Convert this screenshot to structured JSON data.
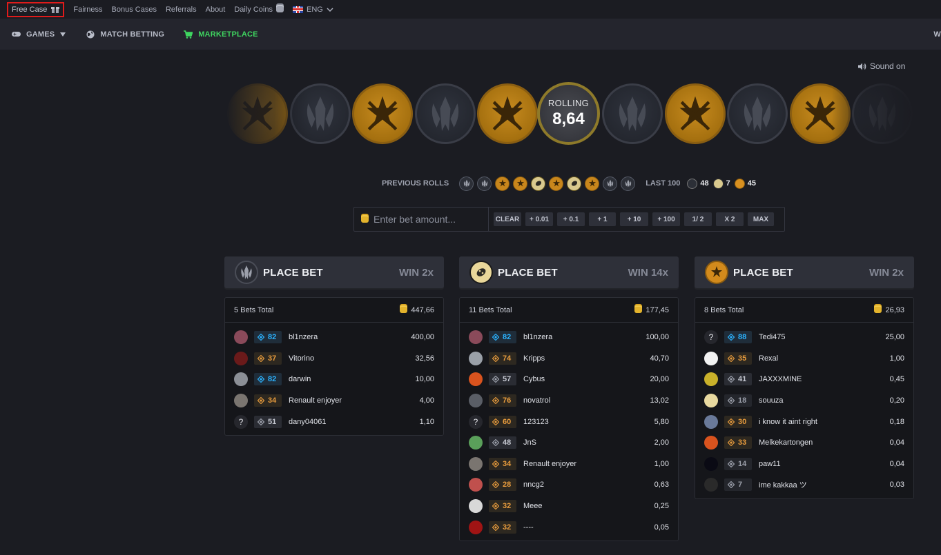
{
  "topbar": {
    "free_case": "Free Case",
    "links": [
      "Fairness",
      "Bonus Cases",
      "Referrals",
      "About",
      "Daily Coins"
    ],
    "language": "ENG"
  },
  "nav": {
    "games": "GAMES",
    "match_betting": "MATCH BETTING",
    "marketplace": "MARKETPLACE",
    "edge_fragment": "W"
  },
  "sound": "Sound on",
  "roll": {
    "label": "ROLLING",
    "value": "8,64",
    "strip": [
      "ct",
      "t",
      "ct",
      "t",
      "ct",
      "ROLL",
      "t",
      "ct",
      "t",
      "ct",
      "t"
    ]
  },
  "previous_rolls": {
    "label": "PREVIOUS ROLLS",
    "items": [
      "t",
      "t",
      "ct",
      "ct",
      "bonus",
      "ct",
      "bonus",
      "ct",
      "t",
      "t"
    ],
    "last100_label": "LAST 100",
    "counts": {
      "t": "48",
      "bonus": "7",
      "ct": "45"
    }
  },
  "bet": {
    "placeholder": "Enter bet amount...",
    "buttons": [
      "CLEAR",
      "+ 0.01",
      "+ 0.1",
      "+ 1",
      "+ 10",
      "+ 100",
      "1/ 2",
      "X 2",
      "MAX"
    ]
  },
  "columns": [
    {
      "place_label": "PLACE BET",
      "win": "WIN 2x",
      "icon": "t-logo-icon",
      "bets_total": "5 Bets Total",
      "sum": "447,66",
      "rows": [
        {
          "level": "82",
          "tier": "blue",
          "name": "bl1nzera",
          "amount": "400,00",
          "avatar": "#8a4a5a"
        },
        {
          "level": "37",
          "tier": "orange",
          "name": "Vitorino",
          "amount": "32,56",
          "avatar": "#6a1a1a"
        },
        {
          "level": "82",
          "tier": "blue",
          "name": "darwin",
          "amount": "10,00",
          "avatar": "#8b8f96"
        },
        {
          "level": "34",
          "tier": "orange",
          "name": "Renault enjoyer",
          "amount": "4,00",
          "avatar": "#7a7570"
        },
        {
          "level": "51",
          "tier": "grey",
          "name": "dany04061",
          "amount": "1,10",
          "avatar": "?"
        }
      ]
    },
    {
      "place_label": "PLACE BET",
      "win": "WIN 14x",
      "icon": "bonus-logo-icon",
      "bets_total": "11 Bets Total",
      "sum": "177,45",
      "rows": [
        {
          "level": "82",
          "tier": "blue",
          "name": "bl1nzera",
          "amount": "100,00",
          "avatar": "#8a4a5a"
        },
        {
          "level": "74",
          "tier": "orange",
          "name": "Kripps",
          "amount": "40,70",
          "avatar": "#9aa0a8"
        },
        {
          "level": "57",
          "tier": "grey",
          "name": "Cybus",
          "amount": "20,00",
          "avatar": "#d9531e"
        },
        {
          "level": "76",
          "tier": "orange",
          "name": "novatrol",
          "amount": "13,02",
          "avatar": "#5a5e66"
        },
        {
          "level": "60",
          "tier": "orange",
          "name": "123123",
          "amount": "5,80",
          "avatar": "?"
        },
        {
          "level": "48",
          "tier": "grey",
          "name": "JnS",
          "amount": "2,00",
          "avatar": "#5aa05a"
        },
        {
          "level": "34",
          "tier": "orange",
          "name": "Renault enjoyer",
          "amount": "1,00",
          "avatar": "#7a7570"
        },
        {
          "level": "28",
          "tier": "orange",
          "name": "nncg2",
          "amount": "0,63",
          "avatar": "#c0504d"
        },
        {
          "level": "32",
          "tier": "orange",
          "name": "Meee",
          "amount": "0,25",
          "avatar": "#d8d8d8"
        },
        {
          "level": "32",
          "tier": "orange",
          "name": "----",
          "amount": "0,05",
          "avatar": "#a01414"
        }
      ]
    },
    {
      "place_label": "PLACE BET",
      "win": "WIN 2x",
      "icon": "ct-logo-icon",
      "bets_total": "8 Bets Total",
      "sum": "26,93",
      "rows": [
        {
          "level": "88",
          "tier": "blue",
          "name": "Tedi475",
          "amount": "25,00",
          "avatar": "?"
        },
        {
          "level": "35",
          "tier": "orange",
          "name": "Rexal",
          "amount": "1,00",
          "avatar": "#f2f2f2"
        },
        {
          "level": "41",
          "tier": "grey",
          "name": "JAXXXMINE",
          "amount": "0,45",
          "avatar": "#c9b12a"
        },
        {
          "level": "18",
          "tier": "dim",
          "name": "souuza",
          "amount": "0,20",
          "avatar": "#e8d9a0"
        },
        {
          "level": "30",
          "tier": "orange",
          "name": "i know it aint right",
          "amount": "0,18",
          "avatar": "#6a7a9a"
        },
        {
          "level": "33",
          "tier": "orange",
          "name": "Melkekartongen",
          "amount": "0,04",
          "avatar": "#d9531e"
        },
        {
          "level": "14",
          "tier": "dim",
          "name": "paw11",
          "amount": "0,04",
          "avatar": "#0a0a14"
        },
        {
          "level": "7",
          "tier": "dim",
          "name": "ime kakkaa ツ",
          "amount": "0,03",
          "avatar": "#2a2a2a"
        }
      ]
    }
  ]
}
